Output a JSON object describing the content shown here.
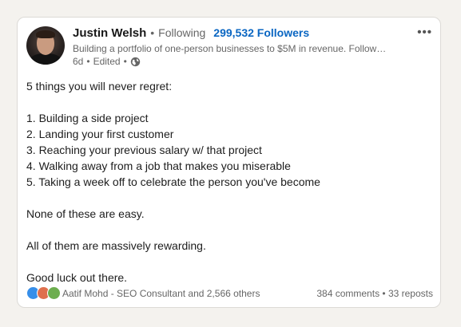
{
  "author": {
    "name": "Justin Welsh",
    "following_label": "Following",
    "followers": "299,532 Followers",
    "headline": "Building a portfolio of one-person businesses to $5M in revenue. Follow…",
    "age": "6d",
    "edited": "Edited"
  },
  "post": {
    "lines": [
      "5 things you will never regret:",
      "",
      "1. Building a side project",
      "2. Landing your first customer",
      "3. Reaching your previous salary w/ that project",
      "4. Walking away from a job that makes you miserable",
      "5. Taking a week off to celebrate the person you've become",
      "",
      "None of these are easy.",
      "",
      "All of them are massively rewarding.",
      "",
      "Good luck out there."
    ]
  },
  "social": {
    "reactions_text": "Aatif Mohd - SEO Consultant and 2,566 others",
    "comments": "384 comments",
    "reposts": "33 reposts",
    "reaction_icons": [
      "like-icon",
      "love-icon",
      "support-icon"
    ]
  },
  "colors": {
    "link": "#0a66c2",
    "background": "#f4f2ee",
    "like": "#378fe9",
    "love": "#df704d",
    "support": "#6dae4f"
  }
}
